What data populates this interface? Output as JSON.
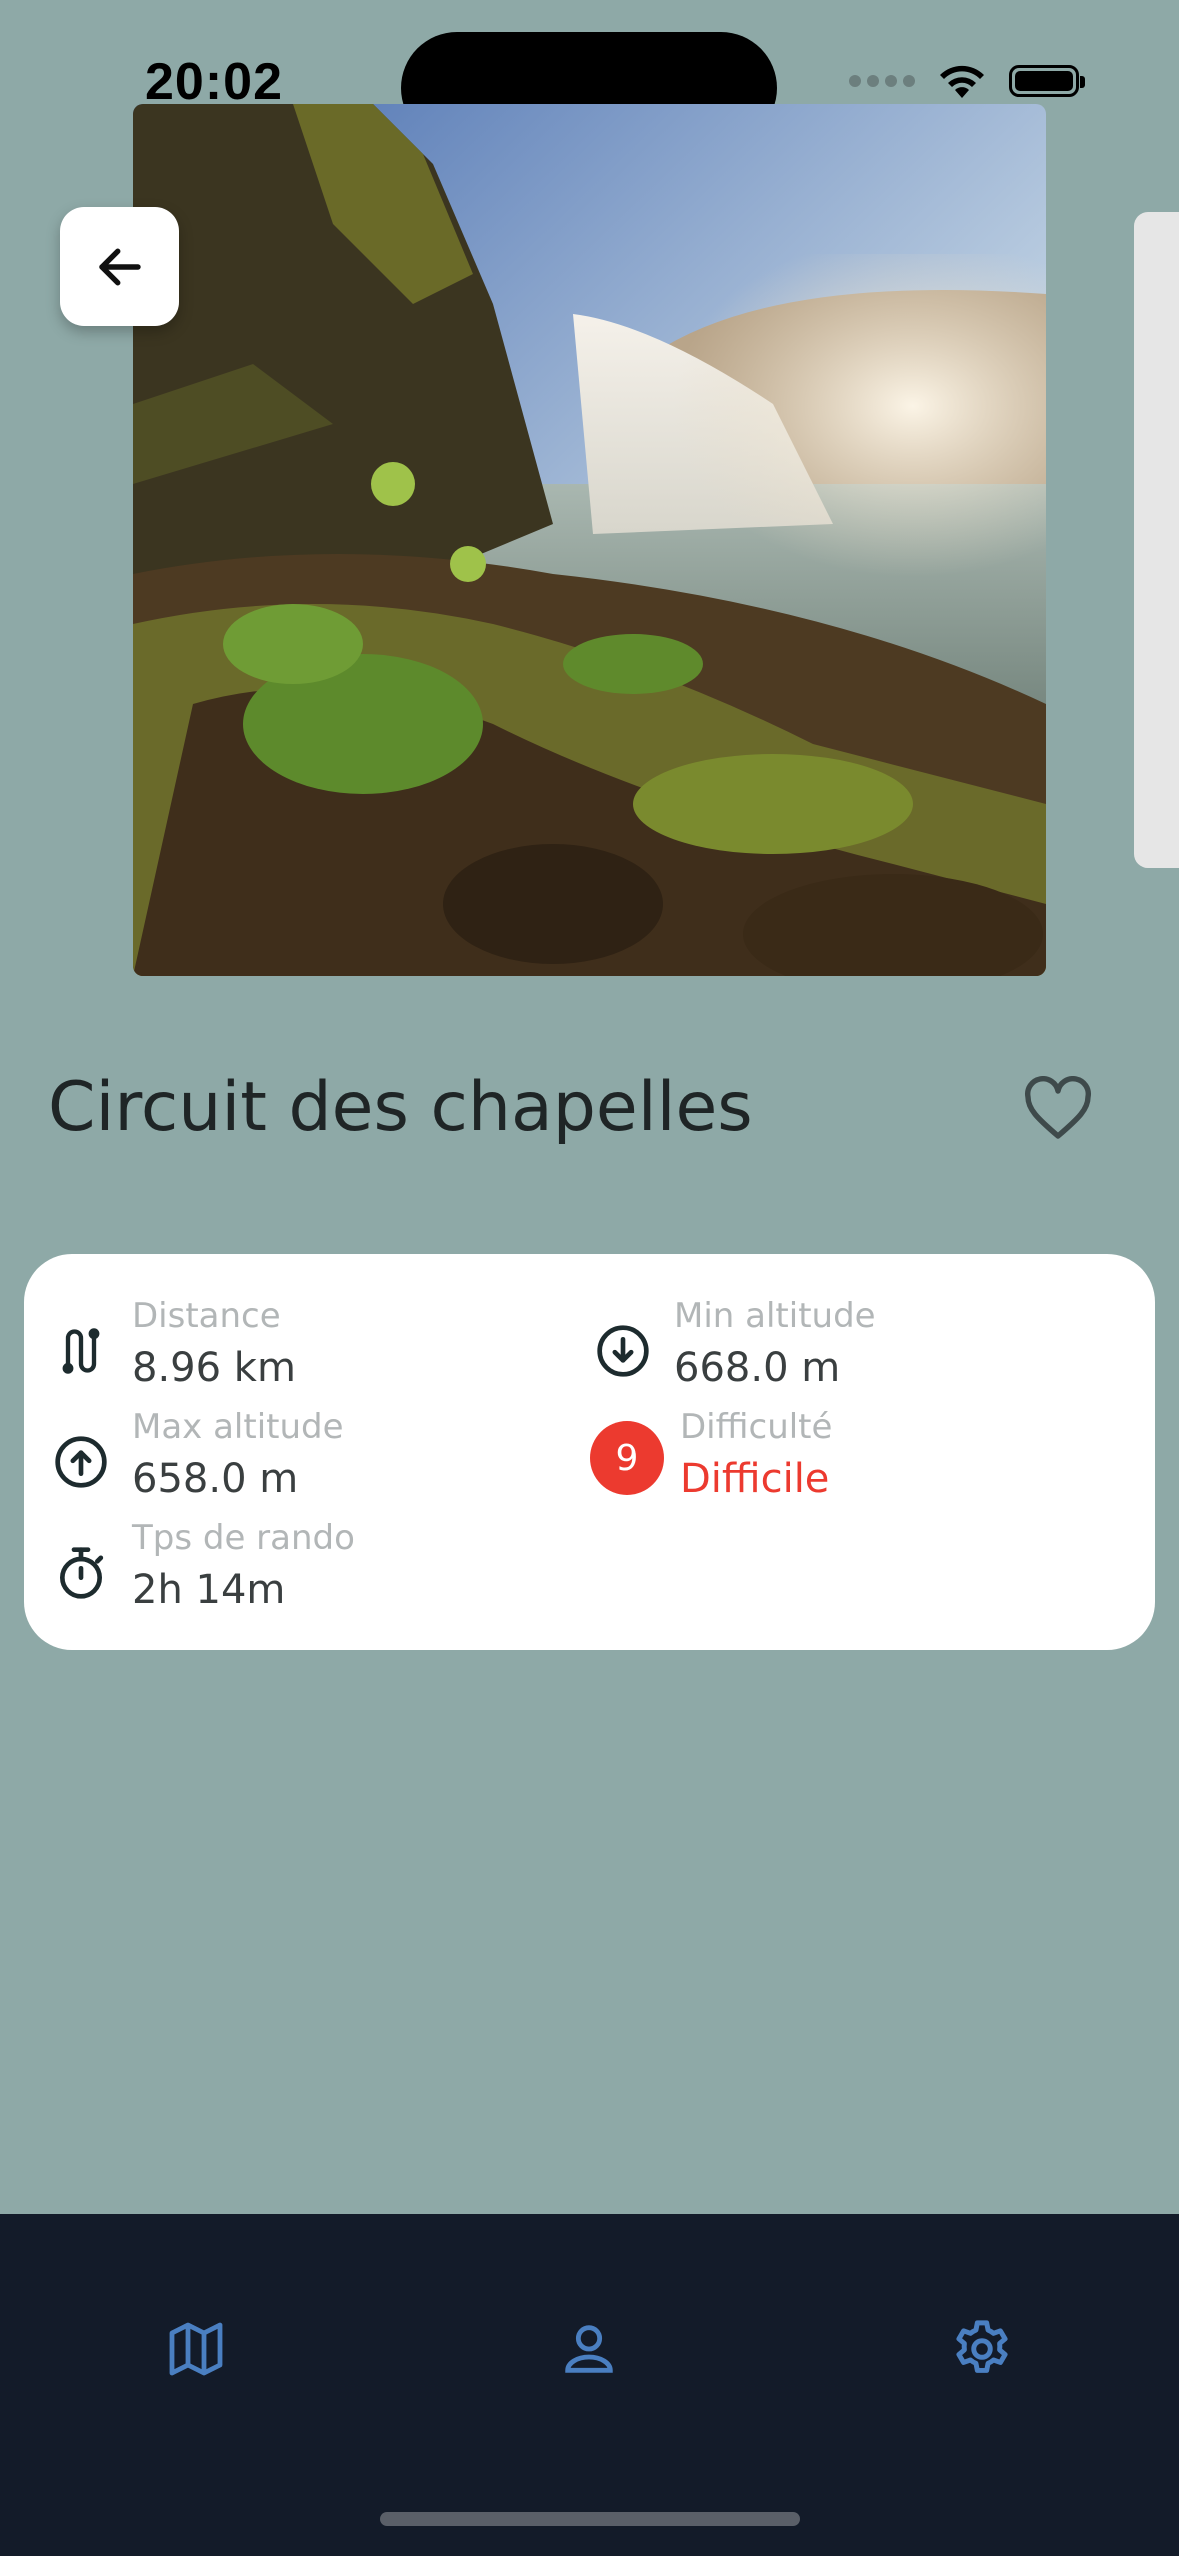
{
  "status_bar": {
    "time": "20:02"
  },
  "trail": {
    "title": "Circuit des chapelles",
    "photo_subject": "waterfall"
  },
  "stats": {
    "distance": {
      "label": "Distance",
      "value": "8.96 km",
      "icon": "route-icon"
    },
    "min_altitude": {
      "label": "Min altitude",
      "value": "668.0 m",
      "icon": "arrow-down-circle-icon"
    },
    "max_altitude": {
      "label": "Max altitude",
      "value": "658.0 m",
      "icon": "arrow-up-circle-icon"
    },
    "difficulty": {
      "label": "Difficulté",
      "value": "Difficile",
      "level": "9",
      "color": "#ec3a2f"
    },
    "hike_time": {
      "label": "Tps de rando",
      "value": "2h 14m",
      "icon": "stopwatch-icon"
    }
  },
  "tabbar": {
    "items": [
      {
        "icon": "map-icon"
      },
      {
        "icon": "user-icon"
      },
      {
        "icon": "gear-icon"
      }
    ],
    "accent": "#4a7fc1",
    "background": "#131b29"
  },
  "colors": {
    "page_background": "#8ea9a7"
  }
}
